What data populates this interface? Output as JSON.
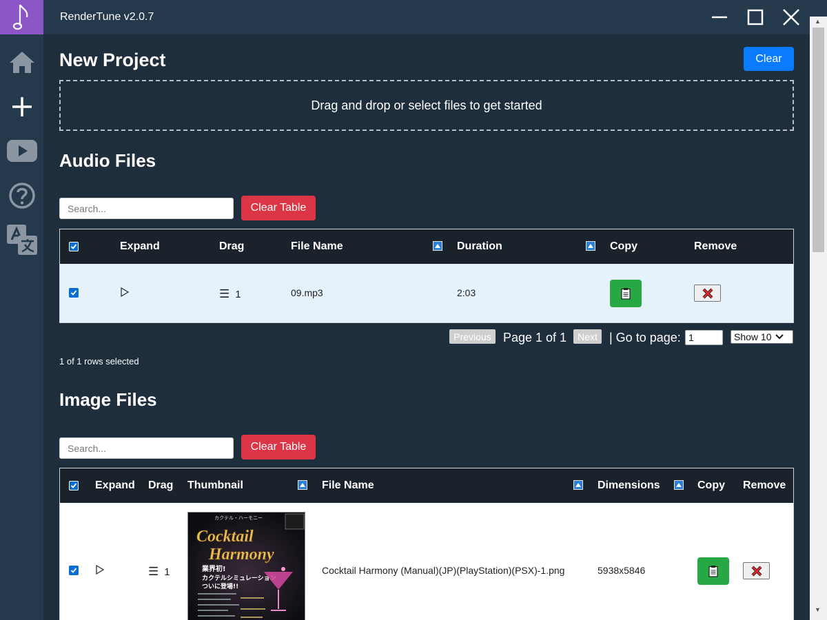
{
  "window": {
    "title": "RenderTune v2.0.7",
    "controls": [
      "minimize",
      "maximize",
      "close"
    ]
  },
  "sidebar": {
    "items": [
      {
        "name": "home",
        "icon": "home-icon"
      },
      {
        "name": "new-project",
        "icon": "plus-icon"
      },
      {
        "name": "youtube",
        "icon": "youtube-icon"
      },
      {
        "name": "help",
        "icon": "help-icon"
      },
      {
        "name": "language",
        "icon": "translate-icon"
      }
    ]
  },
  "page": {
    "title": "New Project",
    "clear_label": "Clear",
    "dropzone_text": "Drag and drop or select files to get started"
  },
  "audio": {
    "heading": "Audio Files",
    "search_placeholder": "Search...",
    "clear_table_label": "Clear Table",
    "columns": {
      "expand": "Expand",
      "drag": "Drag",
      "file_name": "File Name",
      "duration": "Duration",
      "copy": "Copy",
      "remove": "Remove"
    },
    "rows": [
      {
        "selected": true,
        "drag_index": "1",
        "file_name": "09.mp3",
        "duration": "2:03"
      }
    ],
    "pagination": {
      "previous": "Previous",
      "page_text": "Page 1 of 1",
      "next": "Next",
      "goto_label": "| Go to page:",
      "goto_value": "1",
      "show_label": "Show 10"
    },
    "rows_selected_text": "1 of 1 rows selected"
  },
  "images": {
    "heading": "Image Files",
    "search_placeholder": "Search...",
    "clear_table_label": "Clear Table",
    "columns": {
      "expand": "Expand",
      "drag": "Drag",
      "thumbnail": "Thumbnail",
      "file_name": "File Name",
      "dimensions": "Dimensions",
      "copy": "Copy",
      "remove": "Remove"
    },
    "rows": [
      {
        "selected": true,
        "drag_index": "1",
        "file_name": "Cocktail Harmony (Manual)(JP)(PlayStation)(PSX)-1.png",
        "dimensions": "5938x5846",
        "thumbnail_text": {
          "top": "カクテル・ハーモニー",
          "line1": "Cocktail",
          "line2": "Harmony",
          "tagline1": "業界初!",
          "tagline2": "カクテルシミュレーション",
          "tagline3": "ついに登場!!"
        }
      }
    ]
  },
  "colors": {
    "background": "#1f2e3d",
    "sidebar": "#24394c",
    "logo": "#8d56c8",
    "primary": "#0a7bff",
    "danger": "#dc3545",
    "success": "#28a745",
    "selected_row": "#e6f2fb"
  }
}
